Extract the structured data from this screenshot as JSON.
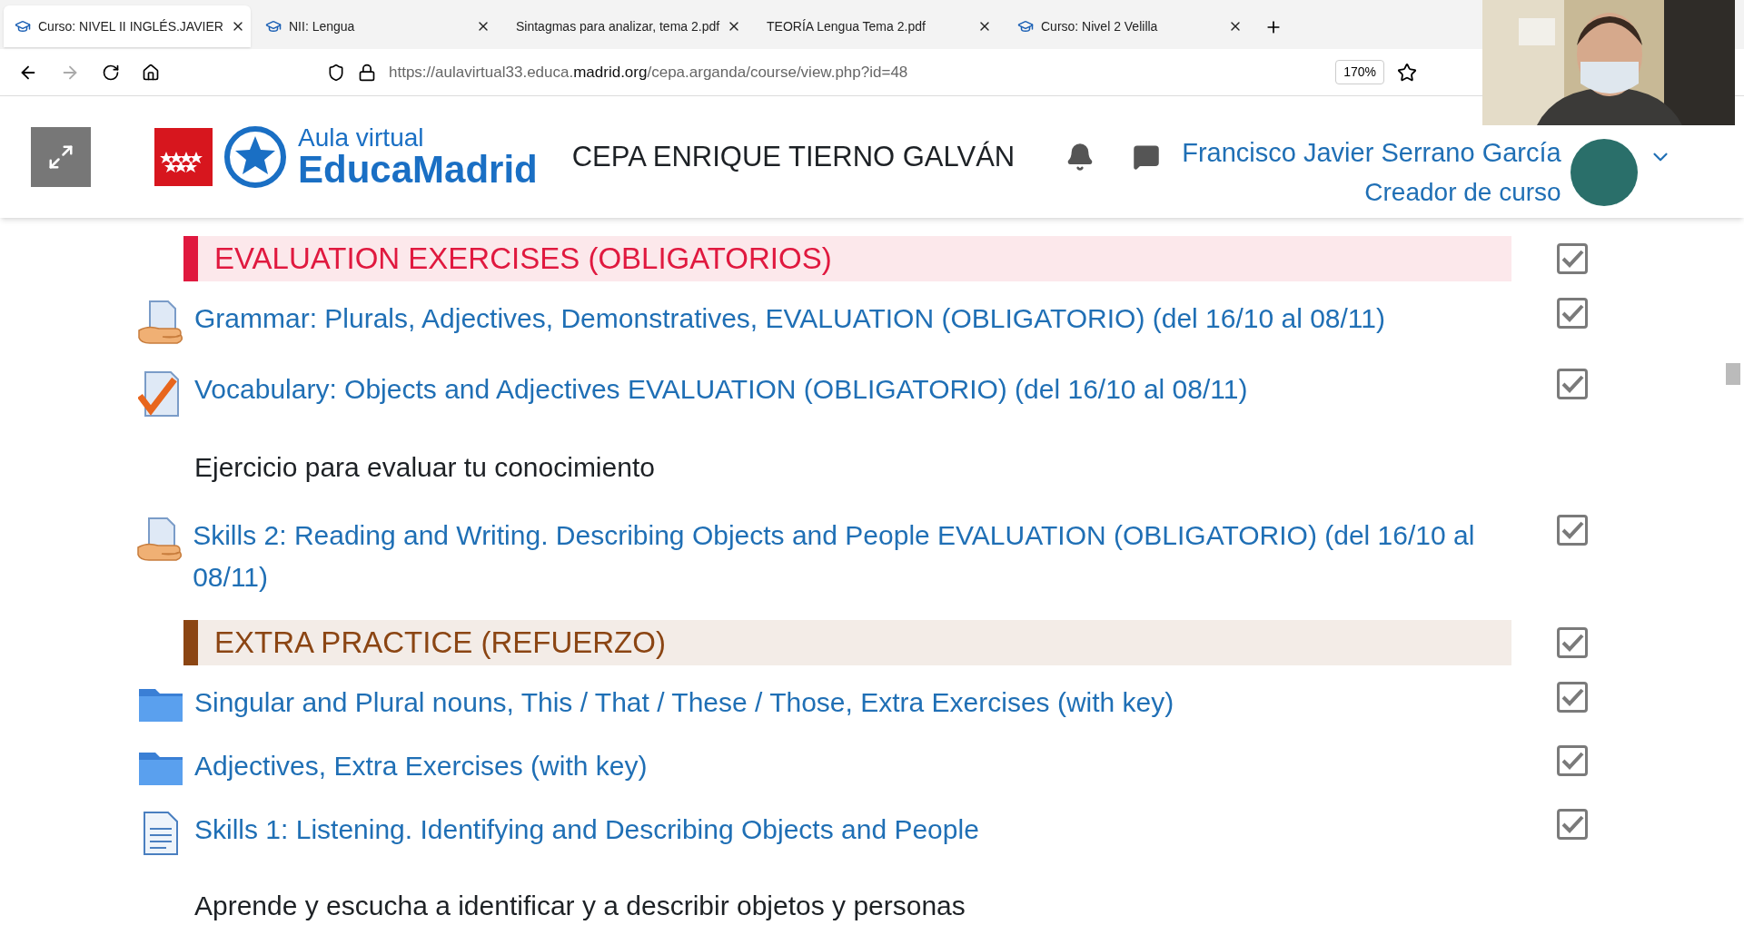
{
  "tabs": [
    {
      "label": "Curso: NIVEL II INGLÉS.JAVIER",
      "kind": "course",
      "selected": true
    },
    {
      "label": "NII: Lengua",
      "kind": "course",
      "selected": false
    },
    {
      "label": "Sintagmas para analizar, tema 2.pdf",
      "kind": "pdf",
      "selected": false
    },
    {
      "label": "TEORÍA Lengua Tema 2.pdf",
      "kind": "pdf",
      "selected": false
    },
    {
      "label": "Curso: Nivel 2 Velilla",
      "kind": "course",
      "selected": false
    }
  ],
  "address_bar": {
    "url_prefix": "https://aulavirtual33.educa.",
    "url_domain": "madrid.org",
    "url_path": "/cepa.arganda/course/view.php?id=48",
    "zoom": "170%"
  },
  "header": {
    "logo_line1": "Aula virtual",
    "logo_line2": "EducaMadrid",
    "school": "CEPA ENRIQUE TIERNO GALVÁN",
    "user_name": "Francisco Javier Serrano García",
    "user_role": "Creador de curso"
  },
  "items": [
    {
      "kind": "section",
      "title": "EVALUATION EXERCISES (OBLIGATORIOS)",
      "color": "#e0193f",
      "completed": true
    },
    {
      "kind": "assignment",
      "title": "Grammar: Plurals, Adjectives, Demonstratives, EVALUATION (OBLIGATORIO) (del 16/10 al 08/11)",
      "completed": true
    },
    {
      "kind": "quiz",
      "title": "Vocabulary: Objects and Adjectives EVALUATION (OBLIGATORIO) (del 16/10 al 08/11)",
      "completed": true
    },
    {
      "kind": "description",
      "title": "Ejercicio para evaluar tu conocimiento"
    },
    {
      "kind": "assignment",
      "title": "Skills 2: Reading and Writing. Describing Objects and People EVALUATION (OBLIGATORIO) (del 16/10 al 08/11)",
      "completed": true
    },
    {
      "kind": "section",
      "title": "EXTRA PRACTICE (REFUERZO)",
      "color": "#8b4513",
      "completed": true
    },
    {
      "kind": "folder",
      "title": "Singular and Plural nouns, This / That / These / Those, Extra Exercises (with key)",
      "completed": true
    },
    {
      "kind": "folder",
      "title": "Adjectives, Extra Exercises (with key)",
      "completed": true
    },
    {
      "kind": "page",
      "title": "Skills 1: Listening. Identifying and Describing Objects and People",
      "completed": true
    },
    {
      "kind": "description",
      "title": "Aprende y escucha a identificar y a describir objetos y personas"
    }
  ]
}
